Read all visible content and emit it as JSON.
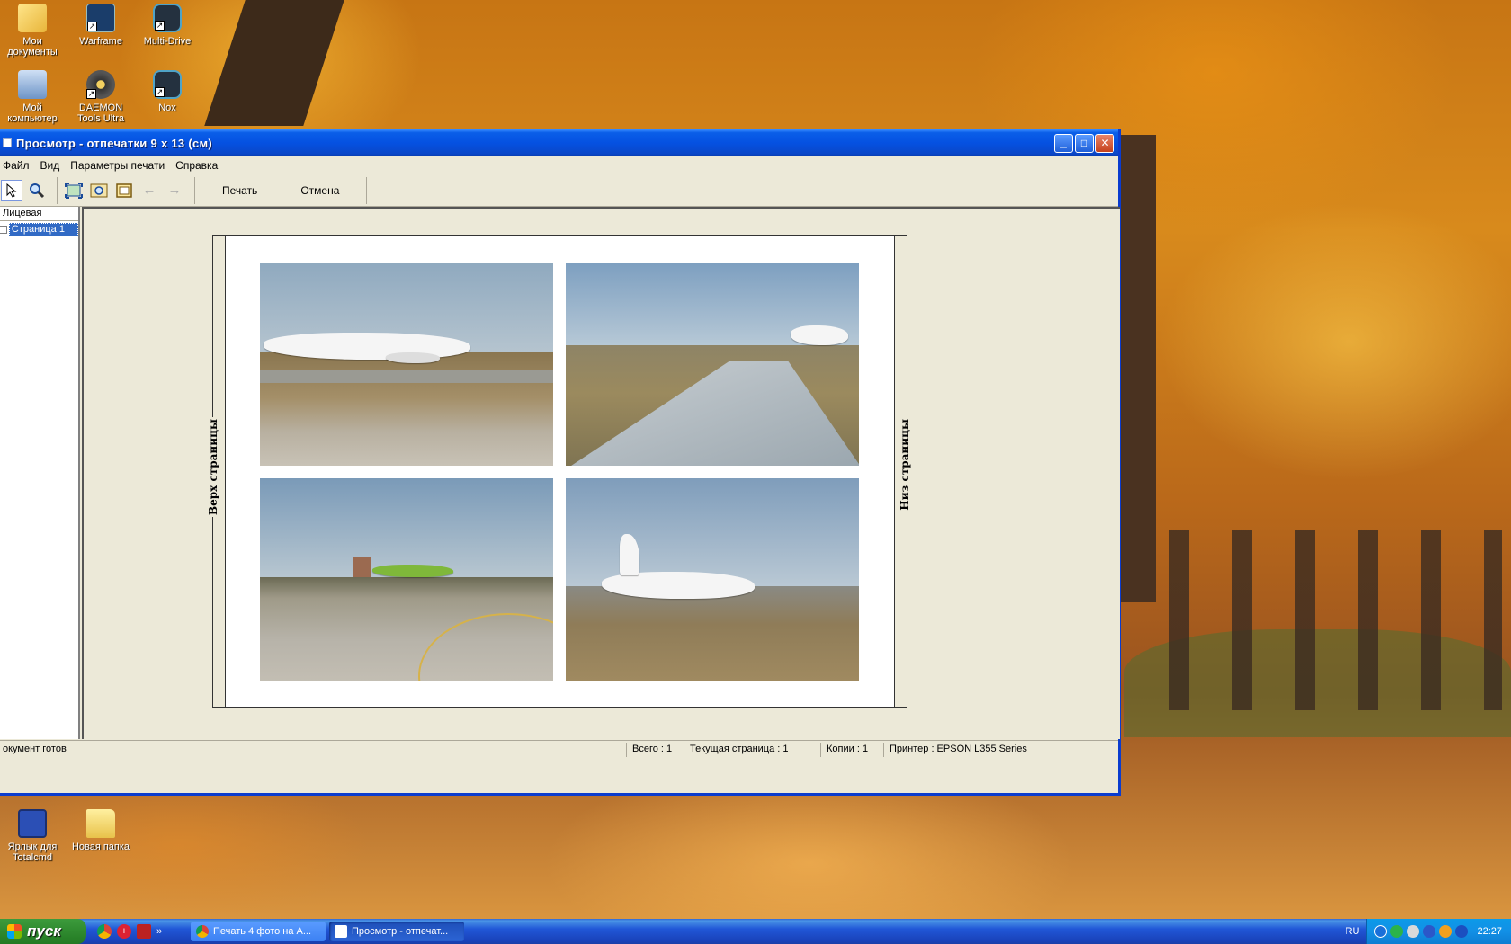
{
  "desktop": {
    "icons": [
      {
        "label": "Мои документы",
        "icon": "documents-folder-icon"
      },
      {
        "label": "Warframe",
        "icon": "warframe-icon"
      },
      {
        "label": "Multi-Drive",
        "icon": "nox-icon"
      },
      {
        "label": "Мой компьютер",
        "icon": "my-computer-icon"
      },
      {
        "label": "DAEMON Tools Ultra",
        "icon": "daemon-tools-icon"
      },
      {
        "label": "Nox",
        "icon": "nox-icon"
      },
      {
        "label": "Ярлык для Totalcmd",
        "icon": "floppy-icon"
      },
      {
        "label": "Новая папка",
        "icon": "folder-icon"
      }
    ]
  },
  "window": {
    "title": "Просмотр - отпечатки 9 x 13 (см)",
    "menu": [
      "Файл",
      "Вид",
      "Параметры печати",
      "Справка"
    ],
    "toolbar": {
      "tools": [
        "pointer-icon",
        "zoom-icon",
        "fit-page-icon",
        "zoom-photo-icon",
        "frame-icon",
        "back-arrow-icon",
        "forward-arrow-icon"
      ],
      "print_label": "Печать",
      "cancel_label": "Отмена"
    },
    "sidebar": {
      "header": "Лицевая",
      "pages": [
        "Страница 1"
      ]
    },
    "preview": {
      "left_label": "Верх страницы",
      "right_label": "Низ страницы",
      "photos": [
        {
          "subject": "white airliner on runway"
        },
        {
          "subject": "view over aircraft wing"
        },
        {
          "subject": "green airliner taxiing"
        },
        {
          "subject": "white four-engine aircraft"
        }
      ]
    },
    "statusbar": {
      "ready": "окумент готов",
      "total": "Всего : 1",
      "current_page": "Текущая страница : 1",
      "copies": "Копии : 1",
      "printer": "Принтер : EPSON L355 Series"
    }
  },
  "taskbar": {
    "start_label": "пуск",
    "tasks": [
      {
        "label": "Печать 4 фото на A...",
        "active": false
      },
      {
        "label": "Просмотр - отпечат...",
        "active": true
      }
    ],
    "language": "RU",
    "clock": "22:27"
  }
}
